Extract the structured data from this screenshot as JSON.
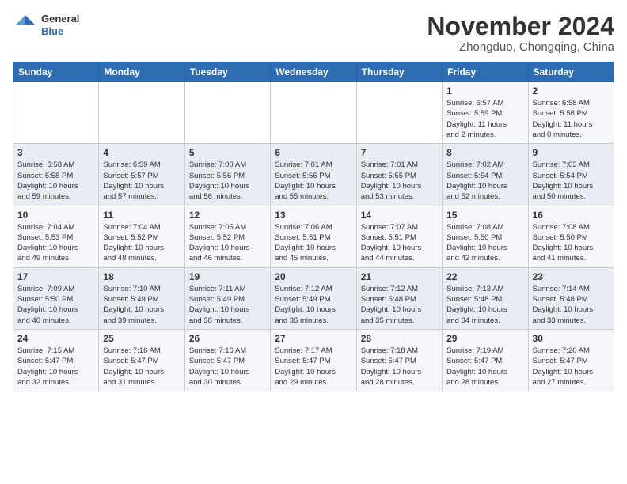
{
  "header": {
    "logo_line1": "General",
    "logo_line2": "Blue",
    "month_title": "November 2024",
    "location": "Zhongduo, Chongqing, China"
  },
  "weekdays": [
    "Sunday",
    "Monday",
    "Tuesday",
    "Wednesday",
    "Thursday",
    "Friday",
    "Saturday"
  ],
  "weeks": [
    [
      {
        "day": "",
        "info": ""
      },
      {
        "day": "",
        "info": ""
      },
      {
        "day": "",
        "info": ""
      },
      {
        "day": "",
        "info": ""
      },
      {
        "day": "",
        "info": ""
      },
      {
        "day": "1",
        "info": "Sunrise: 6:57 AM\nSunset: 5:59 PM\nDaylight: 11 hours\nand 2 minutes."
      },
      {
        "day": "2",
        "info": "Sunrise: 6:58 AM\nSunset: 5:58 PM\nDaylight: 11 hours\nand 0 minutes."
      }
    ],
    [
      {
        "day": "3",
        "info": "Sunrise: 6:58 AM\nSunset: 5:58 PM\nDaylight: 10 hours\nand 59 minutes."
      },
      {
        "day": "4",
        "info": "Sunrise: 6:59 AM\nSunset: 5:57 PM\nDaylight: 10 hours\nand 57 minutes."
      },
      {
        "day": "5",
        "info": "Sunrise: 7:00 AM\nSunset: 5:56 PM\nDaylight: 10 hours\nand 56 minutes."
      },
      {
        "day": "6",
        "info": "Sunrise: 7:01 AM\nSunset: 5:56 PM\nDaylight: 10 hours\nand 55 minutes."
      },
      {
        "day": "7",
        "info": "Sunrise: 7:01 AM\nSunset: 5:55 PM\nDaylight: 10 hours\nand 53 minutes."
      },
      {
        "day": "8",
        "info": "Sunrise: 7:02 AM\nSunset: 5:54 PM\nDaylight: 10 hours\nand 52 minutes."
      },
      {
        "day": "9",
        "info": "Sunrise: 7:03 AM\nSunset: 5:54 PM\nDaylight: 10 hours\nand 50 minutes."
      }
    ],
    [
      {
        "day": "10",
        "info": "Sunrise: 7:04 AM\nSunset: 5:53 PM\nDaylight: 10 hours\nand 49 minutes."
      },
      {
        "day": "11",
        "info": "Sunrise: 7:04 AM\nSunset: 5:52 PM\nDaylight: 10 hours\nand 48 minutes."
      },
      {
        "day": "12",
        "info": "Sunrise: 7:05 AM\nSunset: 5:52 PM\nDaylight: 10 hours\nand 46 minutes."
      },
      {
        "day": "13",
        "info": "Sunrise: 7:06 AM\nSunset: 5:51 PM\nDaylight: 10 hours\nand 45 minutes."
      },
      {
        "day": "14",
        "info": "Sunrise: 7:07 AM\nSunset: 5:51 PM\nDaylight: 10 hours\nand 44 minutes."
      },
      {
        "day": "15",
        "info": "Sunrise: 7:08 AM\nSunset: 5:50 PM\nDaylight: 10 hours\nand 42 minutes."
      },
      {
        "day": "16",
        "info": "Sunrise: 7:08 AM\nSunset: 5:50 PM\nDaylight: 10 hours\nand 41 minutes."
      }
    ],
    [
      {
        "day": "17",
        "info": "Sunrise: 7:09 AM\nSunset: 5:50 PM\nDaylight: 10 hours\nand 40 minutes."
      },
      {
        "day": "18",
        "info": "Sunrise: 7:10 AM\nSunset: 5:49 PM\nDaylight: 10 hours\nand 39 minutes."
      },
      {
        "day": "19",
        "info": "Sunrise: 7:11 AM\nSunset: 5:49 PM\nDaylight: 10 hours\nand 38 minutes."
      },
      {
        "day": "20",
        "info": "Sunrise: 7:12 AM\nSunset: 5:49 PM\nDaylight: 10 hours\nand 36 minutes."
      },
      {
        "day": "21",
        "info": "Sunrise: 7:12 AM\nSunset: 5:48 PM\nDaylight: 10 hours\nand 35 minutes."
      },
      {
        "day": "22",
        "info": "Sunrise: 7:13 AM\nSunset: 5:48 PM\nDaylight: 10 hours\nand 34 minutes."
      },
      {
        "day": "23",
        "info": "Sunrise: 7:14 AM\nSunset: 5:48 PM\nDaylight: 10 hours\nand 33 minutes."
      }
    ],
    [
      {
        "day": "24",
        "info": "Sunrise: 7:15 AM\nSunset: 5:47 PM\nDaylight: 10 hours\nand 32 minutes."
      },
      {
        "day": "25",
        "info": "Sunrise: 7:16 AM\nSunset: 5:47 PM\nDaylight: 10 hours\nand 31 minutes."
      },
      {
        "day": "26",
        "info": "Sunrise: 7:16 AM\nSunset: 5:47 PM\nDaylight: 10 hours\nand 30 minutes."
      },
      {
        "day": "27",
        "info": "Sunrise: 7:17 AM\nSunset: 5:47 PM\nDaylight: 10 hours\nand 29 minutes."
      },
      {
        "day": "28",
        "info": "Sunrise: 7:18 AM\nSunset: 5:47 PM\nDaylight: 10 hours\nand 28 minutes."
      },
      {
        "day": "29",
        "info": "Sunrise: 7:19 AM\nSunset: 5:47 PM\nDaylight: 10 hours\nand 28 minutes."
      },
      {
        "day": "30",
        "info": "Sunrise: 7:20 AM\nSunset: 5:47 PM\nDaylight: 10 hours\nand 27 minutes."
      }
    ]
  ]
}
